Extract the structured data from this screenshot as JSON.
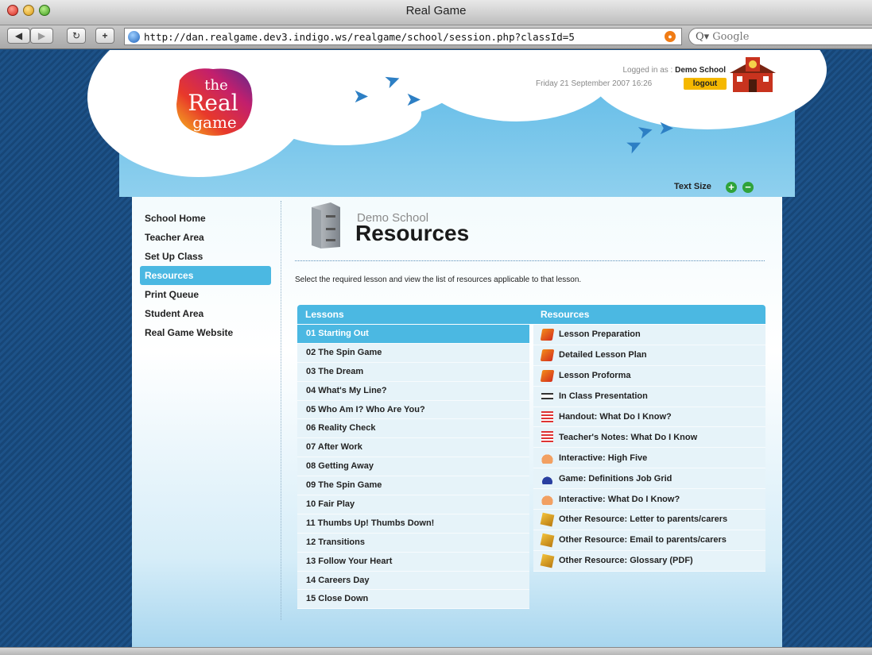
{
  "window": {
    "title": "Real Game"
  },
  "browser": {
    "url": "http://dan.realgame.dev3.indigo.ws/realgame/school/session.php?classId=5",
    "search_placeholder": "Google",
    "search_prefix": "Q▾"
  },
  "header": {
    "logo_text": [
      "the",
      "Real",
      "game"
    ],
    "logged_in_label": "Logged in as : ",
    "school_name": "Demo School",
    "datetime": "Friday 21 September 2007   16:26",
    "logout_label": "logout"
  },
  "text_size": {
    "label": "Text Size",
    "increase": "+",
    "decrease": "−"
  },
  "sidebar": {
    "items": [
      {
        "label": "School Home",
        "active": false
      },
      {
        "label": "Teacher Area",
        "active": false
      },
      {
        "label": "Set Up Class",
        "active": false
      },
      {
        "label": "Resources",
        "active": true
      },
      {
        "label": "Print Queue",
        "active": false
      },
      {
        "label": "Student Area",
        "active": false
      },
      {
        "label": "Real Game Website",
        "active": false
      }
    ]
  },
  "main": {
    "subtitle": "Demo School",
    "title": "Resources",
    "intro": "Select the required lesson and view the list of resources applicable to that lesson.",
    "lessons_header": "Lessons",
    "resources_header": "Resources",
    "lessons": [
      "01 Starting Out",
      "02 The Spin Game",
      "03 The Dream",
      "04 What's My Line?",
      "05 Who Am I? Who Are You?",
      "06 Reality Check",
      "07 After Work",
      "08 Getting Away",
      "09 The Spin Game",
      "10 Fair Play",
      "11 Thumbs Up! Thumbs Down!",
      "12 Transitions",
      "13 Follow Your Heart",
      "14 Careers Day",
      "15 Close Down"
    ],
    "selected_lesson": 0,
    "resources": [
      {
        "label": "Lesson Preparation",
        "icon": "book-icon"
      },
      {
        "label": "Detailed Lesson Plan",
        "icon": "book-icon"
      },
      {
        "label": "Lesson Proforma",
        "icon": "book-icon"
      },
      {
        "label": "In Class Presentation",
        "icon": "presentation-icon"
      },
      {
        "label": "Handout: What Do I Know?",
        "icon": "document-icon"
      },
      {
        "label": "Teacher's Notes: What Do I Know",
        "icon": "document-icon"
      },
      {
        "label": "Interactive: High Five",
        "icon": "hand-icon"
      },
      {
        "label": "Game: Definitions Job Grid",
        "icon": "joystick-icon"
      },
      {
        "label": "Interactive: What Do I Know?",
        "icon": "hand-icon"
      },
      {
        "label": "Other Resource: Letter to parents/carers",
        "icon": "box-icon"
      },
      {
        "label": "Other Resource: Email to parents/carers",
        "icon": "box-icon"
      },
      {
        "label": "Other Resource: Glossary (PDF)",
        "icon": "box-icon"
      }
    ]
  },
  "colors": {
    "accent": "#4bb8e2",
    "logout": "#f5b800",
    "page_bg": "#1c4f82"
  }
}
